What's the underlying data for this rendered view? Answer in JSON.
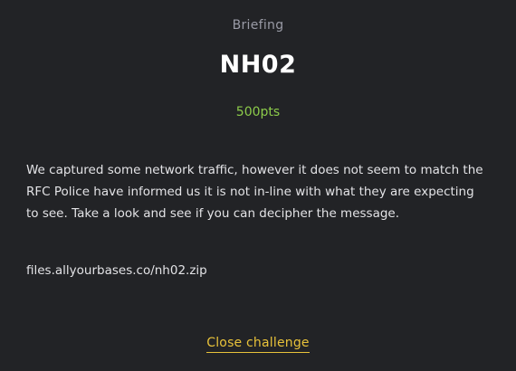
{
  "challenge": {
    "category": "Briefing",
    "title": "NH02",
    "points": "500pts",
    "description": "We captured some network traffic, however it does not seem to match the RFC Police have informed us it is not in-line with what they are expecting to see. Take a look and see if you can decipher the message.",
    "file_link": "files.allyourbases.co/nh02.zip",
    "close_label": "Close challenge"
  },
  "colors": {
    "background": "#222326",
    "points": "#8ccb4a",
    "close": "#e8c23a"
  }
}
